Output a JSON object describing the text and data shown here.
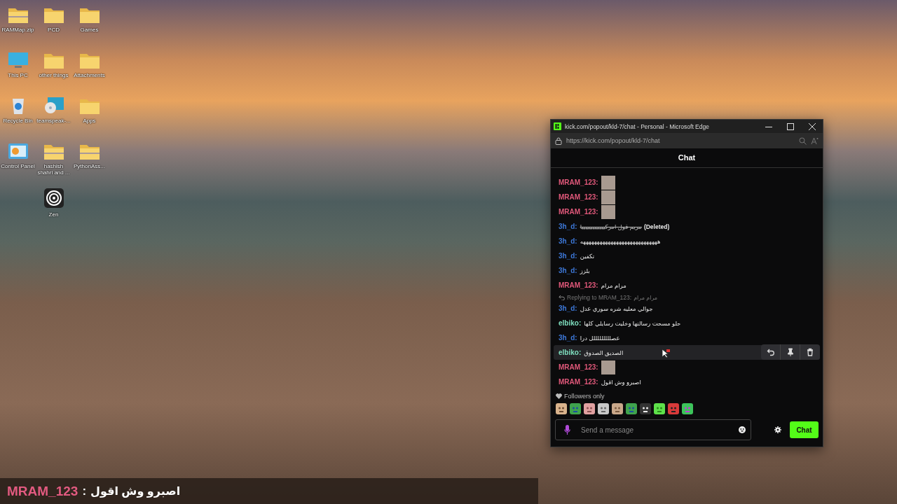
{
  "desktop": {
    "columns": [
      [
        {
          "label": "RAMMap.zip",
          "kind": "zip"
        },
        {
          "label": "This PC",
          "kind": "pc"
        },
        {
          "label": "Recycle Bin",
          "kind": "recycle"
        },
        {
          "label": "Control Panel",
          "kind": "control"
        }
      ],
      [
        {
          "label": "PCD",
          "kind": "folder"
        },
        {
          "label": "other things",
          "kind": "folder"
        },
        {
          "label": "teamspeak-...",
          "kind": "app"
        },
        {
          "label": "hashish shahri and ...",
          "kind": "zip"
        },
        {
          "label": "Zen",
          "kind": "zen"
        }
      ],
      [
        {
          "label": "Games",
          "kind": "folder"
        },
        {
          "label": "Attachments",
          "kind": "folder"
        },
        {
          "label": "Apps",
          "kind": "folder"
        },
        {
          "label": "PythonAss...",
          "kind": "zip"
        }
      ]
    ]
  },
  "window": {
    "title": "kick.com/popout/kld-7/chat - Personal - Microsoft Edge",
    "url": "https://kick.com/popout/kld-7/chat"
  },
  "chat": {
    "title": "Chat",
    "messages": [
      {
        "user": "MRAM_123:",
        "color": "#e0587a",
        "kind": "image",
        "hovered": false
      },
      {
        "user": "MRAM_123:",
        "color": "#e0587a",
        "kind": "image",
        "hovered": false
      },
      {
        "user": "MRAM_123:",
        "color": "#e0587a",
        "kind": "image",
        "hovered": false
      },
      {
        "user": "3h_d:",
        "color": "#3d78d8",
        "kind": "deleted",
        "text": "مريم قول امركيييييييييييييا",
        "note": "(Deleted)",
        "hovered": false
      },
      {
        "user": "3h_d:",
        "color": "#3d78d8",
        "kind": "text",
        "text": "ههههههههههههههههههههههههههههه",
        "hovered": false
      },
      {
        "user": "3h_d:",
        "color": "#3d78d8",
        "kind": "text",
        "text": "تكفين",
        "hovered": false
      },
      {
        "user": "3h_d:",
        "color": "#3d78d8",
        "kind": "text",
        "text": "بلزز",
        "hovered": false
      },
      {
        "user": "MRAM_123:",
        "color": "#e0587a",
        "kind": "text",
        "text": "مرام مرام",
        "hovered": false
      },
      {
        "user": "3h_d:",
        "color": "#3d78d8",
        "kind": "text",
        "text": "جوالي معليه شره سوري عدل",
        "reply": {
          "label": "Replying to MRAM_123:",
          "quote": "مرام مرام"
        },
        "hovered": false
      },
      {
        "user": "elbiko:",
        "color": "#7fe0c0",
        "kind": "text",
        "text": "حلو مسحت رسالتها وخليت رسايلي كلها",
        "hovered": false
      },
      {
        "user": "3h_d:",
        "color": "#3d78d8",
        "kind": "text",
        "text": "عصلللللللللل درا",
        "hovered": false
      },
      {
        "user": "elbiko:",
        "color": "#7fe0c0",
        "kind": "text",
        "text": "الصديق الصدوق",
        "hovered": true
      },
      {
        "user": "MRAM_123:",
        "color": "#e0587a",
        "kind": "image",
        "hovered": false
      },
      {
        "user": "MRAM_123:",
        "color": "#e0587a",
        "kind": "text",
        "text": "اصبرو وش اقول",
        "hovered": false
      }
    ],
    "mode": "Followers only",
    "emotes": [
      {
        "kind": "cat"
      },
      {
        "kind": "frog"
      },
      {
        "kind": "pink-cat"
      },
      {
        "kind": "grey-cat"
      },
      {
        "kind": "hamster"
      },
      {
        "kind": "frog"
      },
      {
        "kind": "mute"
      },
      {
        "kind": "blob"
      },
      {
        "kind": "angry"
      },
      {
        "kind": "headphones"
      }
    ],
    "input": {
      "placeholder": "Send a message"
    },
    "send_button": "Chat"
  },
  "caption": {
    "user": "MRAM_123",
    "separator": ":",
    "text": "اصبرو وش اقول"
  }
}
